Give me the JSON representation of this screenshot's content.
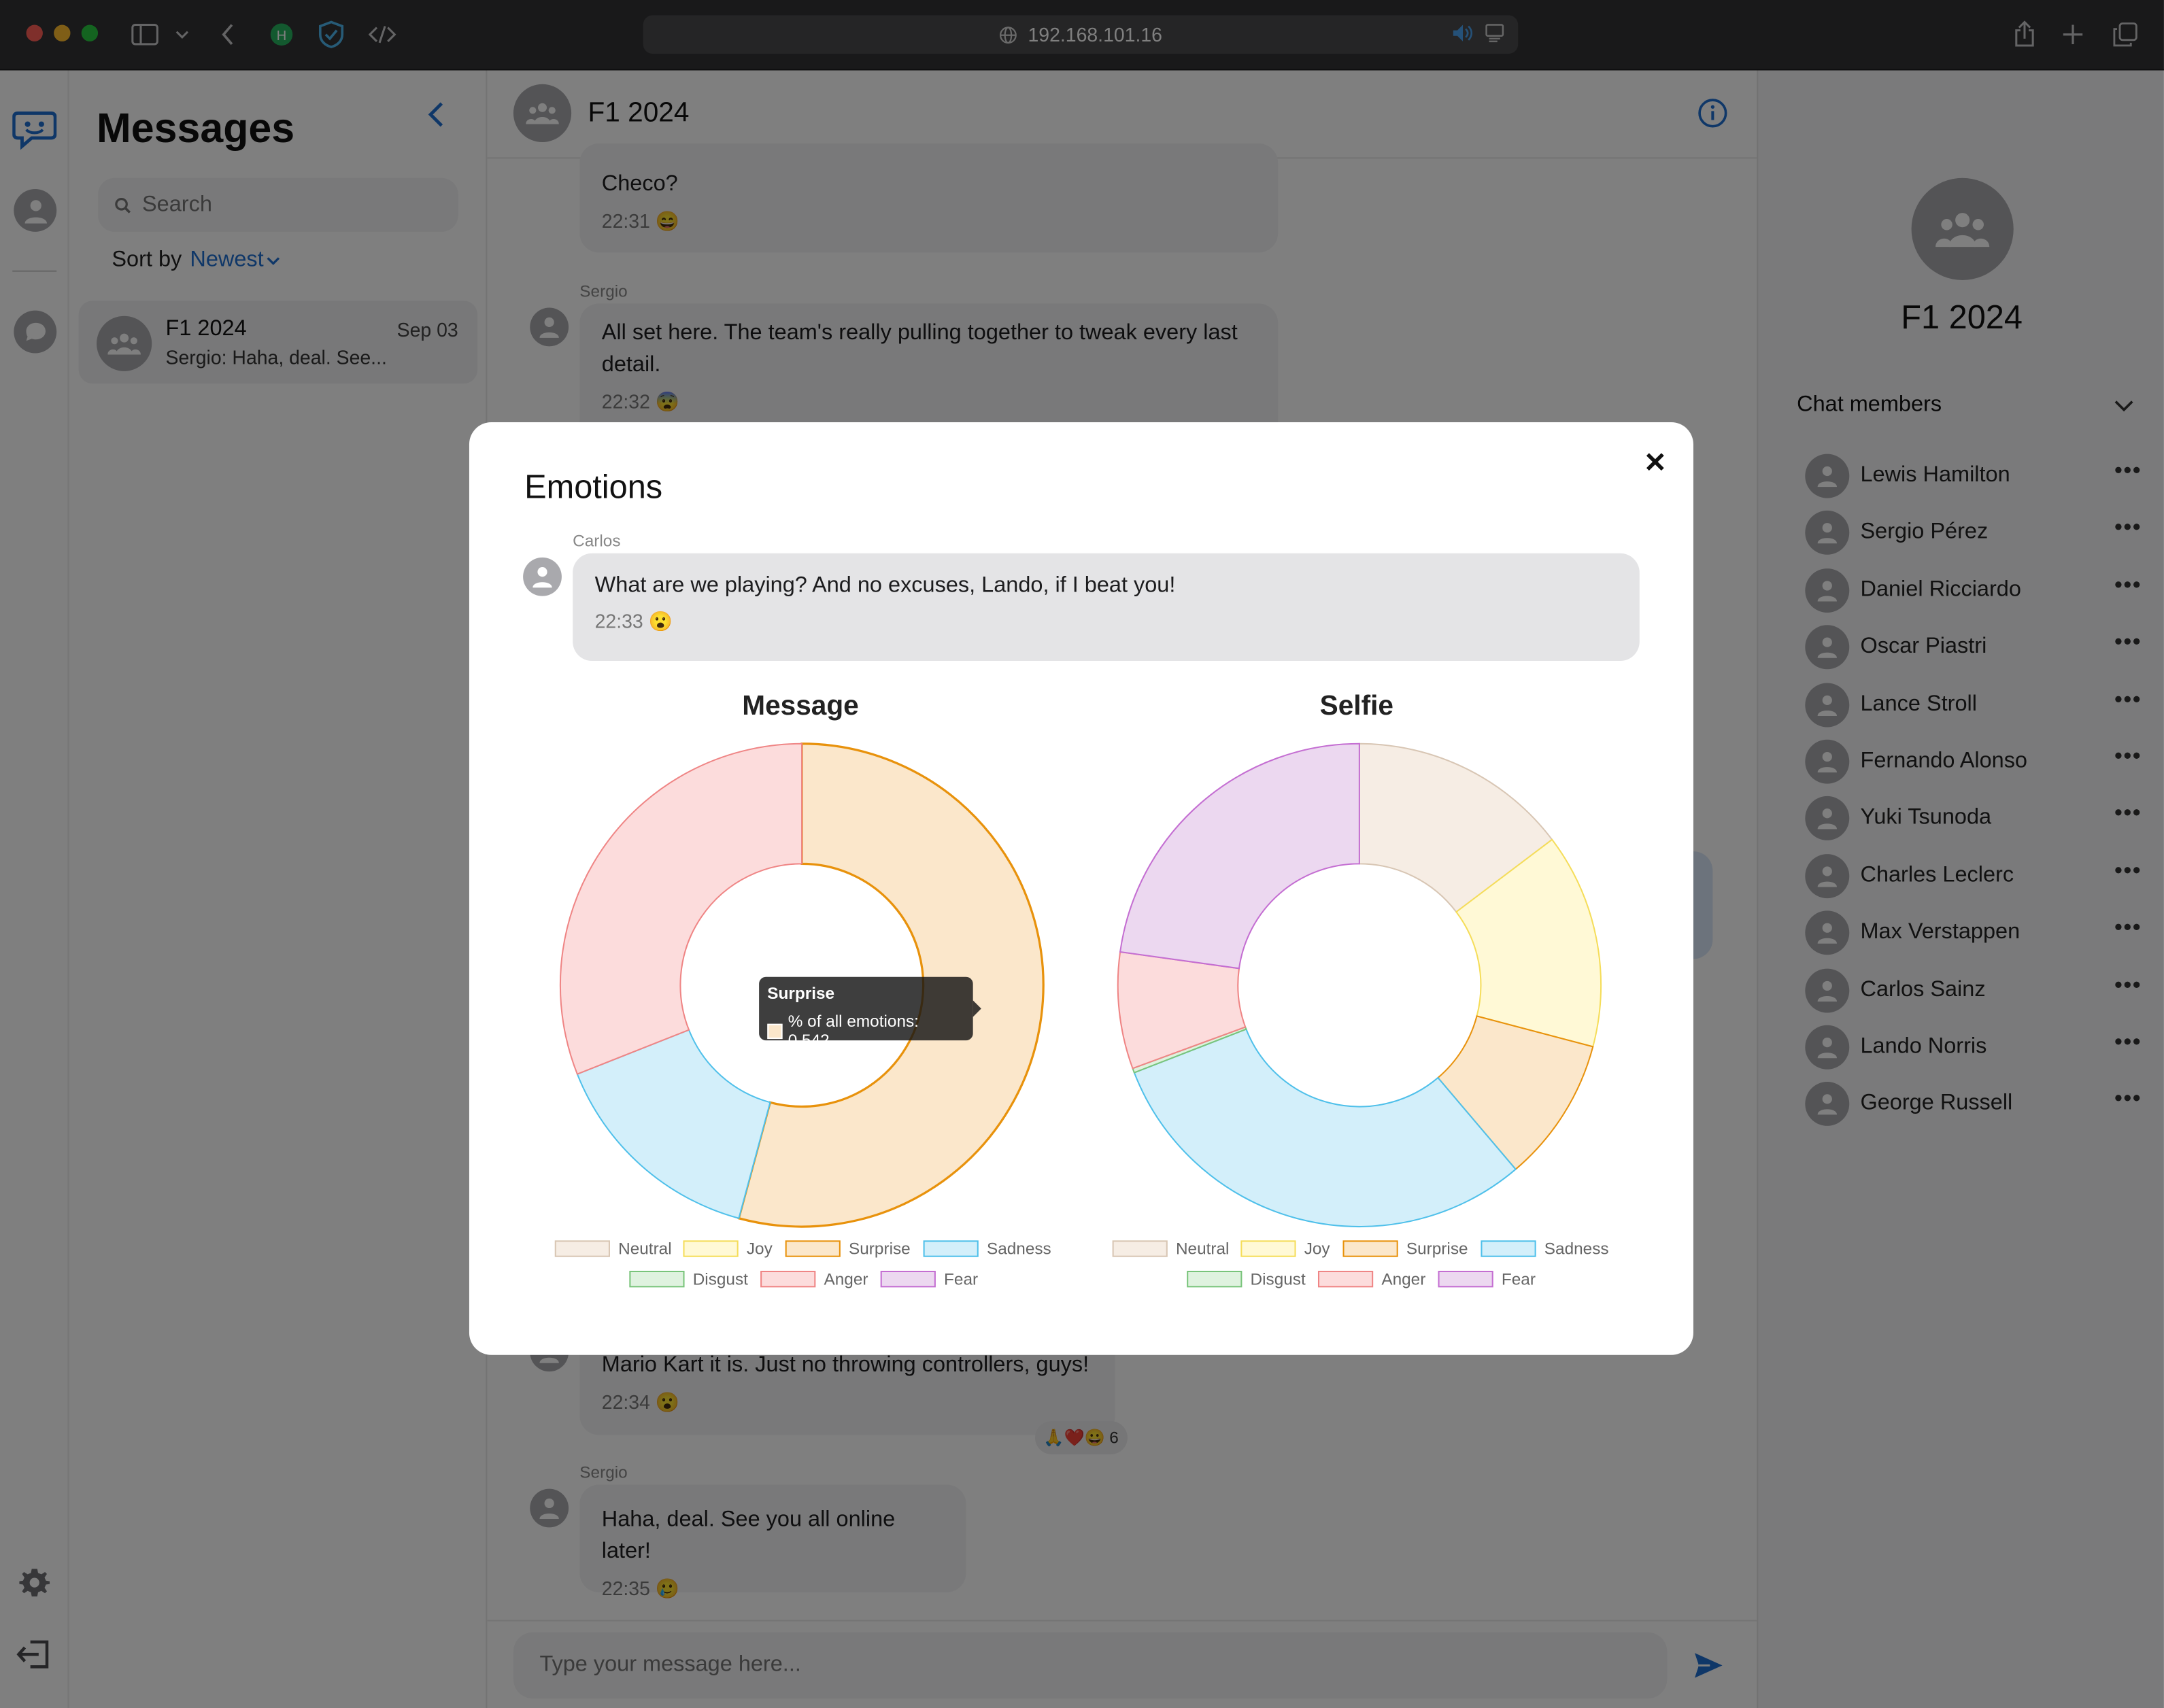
{
  "browser": {
    "address": "192.168.101.16"
  },
  "sidebar": {
    "title": "Messages",
    "search_placeholder": "Search",
    "sort_label": "Sort by",
    "sort_value": "Newest"
  },
  "conversations": [
    {
      "name": "F1 2024",
      "date": "Sep 03",
      "preview": "Sergio: Haha, deal. See..."
    }
  ],
  "chat": {
    "title": "F1 2024",
    "input_placeholder": "Type your message here...",
    "messages": [
      {
        "text": "Checo?",
        "time": "22:31",
        "emoji": "😄"
      },
      {
        "sender": "Sergio",
        "text": "All set here. The team's really pulling together to tweak every last detail.",
        "time": "22:32",
        "emoji": "😨"
      },
      {
        "text": "Mario Kart it is. Just no throwing controllers, guys!",
        "time": "22:34",
        "emoji": "😮",
        "reactions": "🙏❤️😀",
        "reaction_count": "6"
      },
      {
        "sender": "Sergio",
        "text": "Haha, deal. See you all online later!",
        "time": "22:35",
        "emoji": "🥲"
      }
    ]
  },
  "info": {
    "title": "F1 2024",
    "members_label": "Chat members",
    "members": [
      "Lewis Hamilton",
      "Sergio Pérez",
      "Daniel Ricciardo",
      "Oscar Piastri",
      "Lance Stroll",
      "Fernando Alonso",
      "Yuki Tsunoda",
      "Charles Leclerc",
      "Max Verstappen",
      "Carlos Sainz",
      "Lando Norris",
      "George Russell"
    ]
  },
  "modal": {
    "title": "Emotions",
    "close": "✕",
    "message": {
      "sender": "Carlos",
      "text": "What are we playing? And no excuses, Lando, if I beat you!",
      "time": "22:33",
      "emoji": "😮"
    },
    "tooltip": {
      "title": "Surprise",
      "label": "% of all emotions: 0.542"
    }
  },
  "colors": {
    "Neutral": {
      "fill": "#f6ede4",
      "stroke": "#d8c6b4"
    },
    "Joy": {
      "fill": "#fff9d6",
      "stroke": "#f5dd5a"
    },
    "Surprise": {
      "fill": "#fbe7cb",
      "stroke": "#e8920c"
    },
    "Sadness": {
      "fill": "#d3effa",
      "stroke": "#4fc0ea"
    },
    "Disgust": {
      "fill": "#dff2df",
      "stroke": "#79c47b"
    },
    "Anger": {
      "fill": "#fcdcdc",
      "stroke": "#ef8585"
    },
    "Fear": {
      "fill": "#ecd8f0",
      "stroke": "#c46ed2"
    },
    "accent": "#1f6fd0"
  },
  "chart_data": [
    {
      "type": "pie",
      "title": "Message",
      "categories": [
        "Neutral",
        "Joy",
        "Surprise",
        "Sadness",
        "Disgust",
        "Anger",
        "Fear"
      ],
      "values": [
        0,
        0,
        0.542,
        0.148,
        0,
        0.31,
        0
      ],
      "legend": "bottom"
    },
    {
      "type": "pie",
      "title": "Selfie",
      "categories": [
        "Neutral",
        "Joy",
        "Surprise",
        "Sadness",
        "Disgust",
        "Anger",
        "Fear"
      ],
      "values": [
        0.147,
        0.144,
        0.097,
        0.303,
        0.003,
        0.078,
        0.228
      ],
      "legend": "bottom"
    }
  ]
}
